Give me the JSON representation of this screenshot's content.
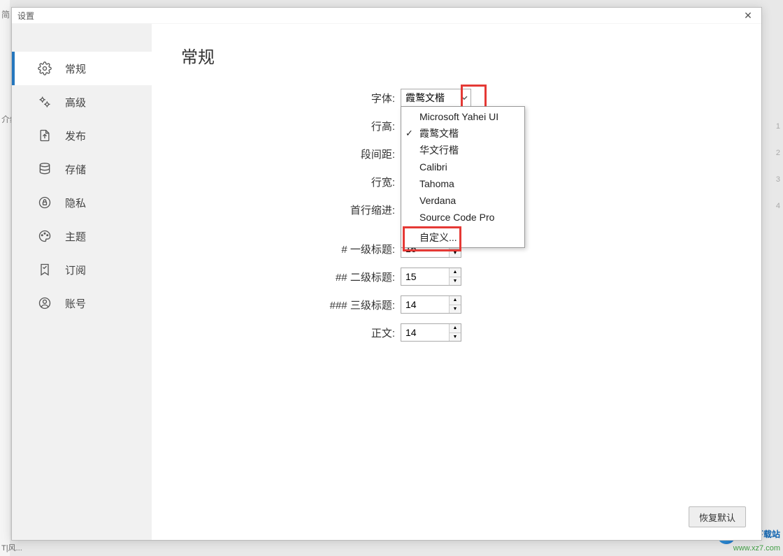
{
  "background": {
    "left_truncated": [
      "简",
      "",
      "介绍"
    ],
    "bottom_left": "T|风...",
    "right_nums": [
      "1",
      "2",
      "3",
      "4"
    ]
  },
  "dialog": {
    "title": "设置",
    "close_symbol": "✕",
    "page_title": "常规",
    "sidebar": [
      {
        "key": "general",
        "label": "常规",
        "icon": "gear-icon",
        "active": true
      },
      {
        "key": "advanced",
        "label": "高级",
        "icon": "gears-icon",
        "active": false
      },
      {
        "key": "publish",
        "label": "发布",
        "icon": "upload-file-icon",
        "active": false
      },
      {
        "key": "storage",
        "label": "存储",
        "icon": "database-icon",
        "active": false
      },
      {
        "key": "privacy",
        "label": "隐私",
        "icon": "lock-icon",
        "active": false
      },
      {
        "key": "theme",
        "label": "主题",
        "icon": "palette-icon",
        "active": false
      },
      {
        "key": "subscribe",
        "label": "订阅",
        "icon": "bookmark-icon",
        "active": false
      },
      {
        "key": "account",
        "label": "账号",
        "icon": "user-icon",
        "active": false
      }
    ],
    "form": {
      "font": {
        "label": "字体:",
        "value": "霞鹜文楷"
      },
      "line_height": {
        "label": "行高:"
      },
      "para_space": {
        "label": "段间距:"
      },
      "line_width": {
        "label": "行宽:"
      },
      "indent": {
        "label": "首行缩进:"
      },
      "h1": {
        "label": "# 一级标题:",
        "value": "16"
      },
      "h2": {
        "label": "## 二级标题:",
        "value": "15"
      },
      "h3": {
        "label": "### 三级标题:",
        "value": "14"
      },
      "body": {
        "label": "正文:",
        "value": "14"
      }
    },
    "font_dropdown": {
      "options": [
        {
          "label": "Microsoft Yahei UI",
          "selected": false
        },
        {
          "label": "霞鹜文楷",
          "selected": true
        },
        {
          "label": "华文行楷",
          "selected": false
        },
        {
          "label": "Calibri",
          "selected": false
        },
        {
          "label": "Tahoma",
          "selected": false
        },
        {
          "label": "Verdana",
          "selected": false
        },
        {
          "label": "Source Code Pro",
          "selected": false
        }
      ],
      "custom_label": "自定义..."
    },
    "footer": {
      "restore_defaults": "恢复默认"
    }
  },
  "watermark": {
    "cn": "极光下载站",
    "url": "www.xz7.com"
  }
}
